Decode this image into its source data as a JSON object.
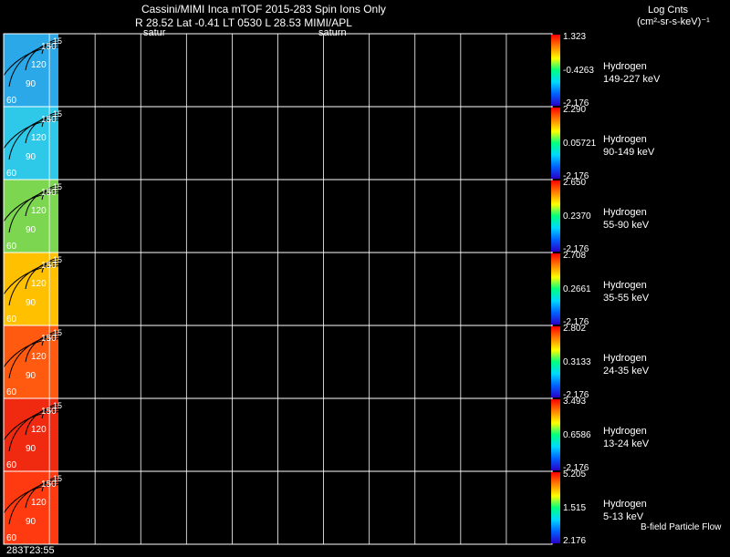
{
  "header": {
    "title": "Cassini/MIMI Inca mTOF  2015-283   Spin   Ions Only",
    "info_line": "R          28.52  Lat -0.41  LT  0530  L          28.53  MIMI/APL",
    "saturn_label_1": "satur",
    "saturn_label_2": "saturn",
    "units_line1": "Log Cnts",
    "units_line2": "(cm²-sr-s-keV)⁻¹",
    "footer_left": "283T23:55",
    "footer_right": "B-field Particle Flow"
  },
  "colors": {
    "background": "#000000",
    "grid": "#ffffff",
    "colorbar": [
      "#2a00c8",
      "#0060ff",
      "#00d8ff",
      "#00ff80",
      "#ffff00",
      "#ff8000",
      "#ff0000"
    ]
  },
  "chart_data": {
    "type": "heatmap",
    "panels": [
      {
        "species": "Hydrogen",
        "energy": "149-227 keV",
        "cbar_max": "1.323",
        "cbar_mid": "-0.4263",
        "cbar_min": "-2.176",
        "fill": "#2aa8e8"
      },
      {
        "species": "Hydrogen",
        "energy": "90-149 keV",
        "cbar_max": "2.290",
        "cbar_mid": "0.05721",
        "cbar_min": "-2.176",
        "fill": "#2ec8e8"
      },
      {
        "species": "Hydrogen",
        "energy": "55-90 keV",
        "cbar_max": "2.650",
        "cbar_mid": "0.2370",
        "cbar_min": "-2.176",
        "fill": "#7cd650"
      },
      {
        "species": "Hydrogen",
        "energy": "35-55 keV",
        "cbar_max": "2.708",
        "cbar_mid": "0.2661",
        "cbar_min": "-2.176",
        "fill": "#ffc000"
      },
      {
        "species": "Hydrogen",
        "energy": "24-35 keV",
        "cbar_max": "2.802",
        "cbar_mid": "0.3133",
        "cbar_min": "-2.176",
        "fill": "#ff5a10"
      },
      {
        "species": "Hydrogen",
        "energy": "13-24 keV",
        "cbar_max": "3.493",
        "cbar_mid": "0.6586",
        "cbar_min": "-2.176",
        "fill": "#f02a10"
      },
      {
        "species": "Hydrogen",
        "energy": "5-13 keV",
        "cbar_max": "5.205",
        "cbar_mid": "1.515",
        "cbar_min": "2.176",
        "fill": "#ff3a10"
      }
    ],
    "contour_labels": [
      "150",
      "120",
      "90",
      "60"
    ],
    "contour_extra_label": "15",
    "grid": true,
    "columns": 12
  }
}
